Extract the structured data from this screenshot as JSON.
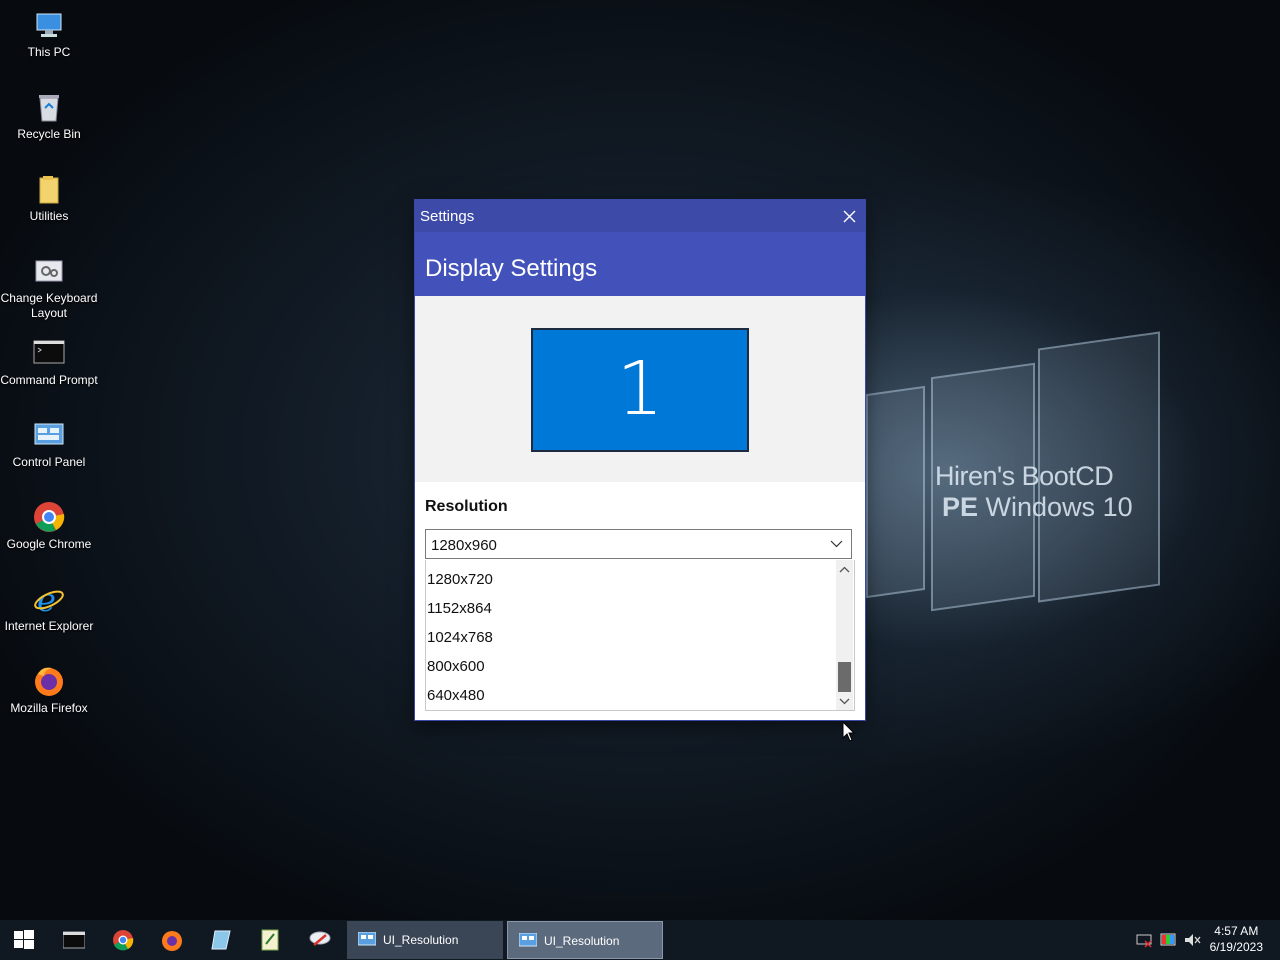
{
  "desktop": {
    "icons": [
      {
        "label": "This PC",
        "icon": "this-pc-icon"
      },
      {
        "label": "Recycle Bin",
        "icon": "recycle-bin-icon"
      },
      {
        "label": "Utilities",
        "icon": "folder-icon"
      },
      {
        "label": "Change Keyboard Layout",
        "icon": "keyboard-settings-icon"
      },
      {
        "label": "Command Prompt",
        "icon": "command-prompt-icon"
      },
      {
        "label": "Control Panel",
        "icon": "control-panel-icon"
      },
      {
        "label": "Google Chrome",
        "icon": "chrome-icon"
      },
      {
        "label": "Internet Explorer",
        "icon": "internet-explorer-icon"
      },
      {
        "label": "Mozilla Firefox",
        "icon": "firefox-icon"
      }
    ],
    "watermark": {
      "line1": "Hiren's BootCD",
      "line2_bold": "PE",
      "line2_rest": " Windows 10"
    }
  },
  "window": {
    "title": "Settings",
    "header": "Display Settings",
    "monitor_number": "1",
    "resolution_label": "Resolution",
    "selected_resolution": "1280x960",
    "options": [
      "1280x720",
      "1152x864",
      "1024x768",
      "800x600",
      "640x480"
    ]
  },
  "taskbar": {
    "tasks": [
      {
        "label": "UI_Resolution",
        "active": false
      },
      {
        "label": "UI_Resolution",
        "active": true
      }
    ],
    "clock": {
      "time": "4:57 AM",
      "date": "6/19/2023"
    }
  },
  "colors": {
    "titlebar": "#3d4aa8",
    "header": "#4352bb",
    "monitor": "#0078d7"
  }
}
